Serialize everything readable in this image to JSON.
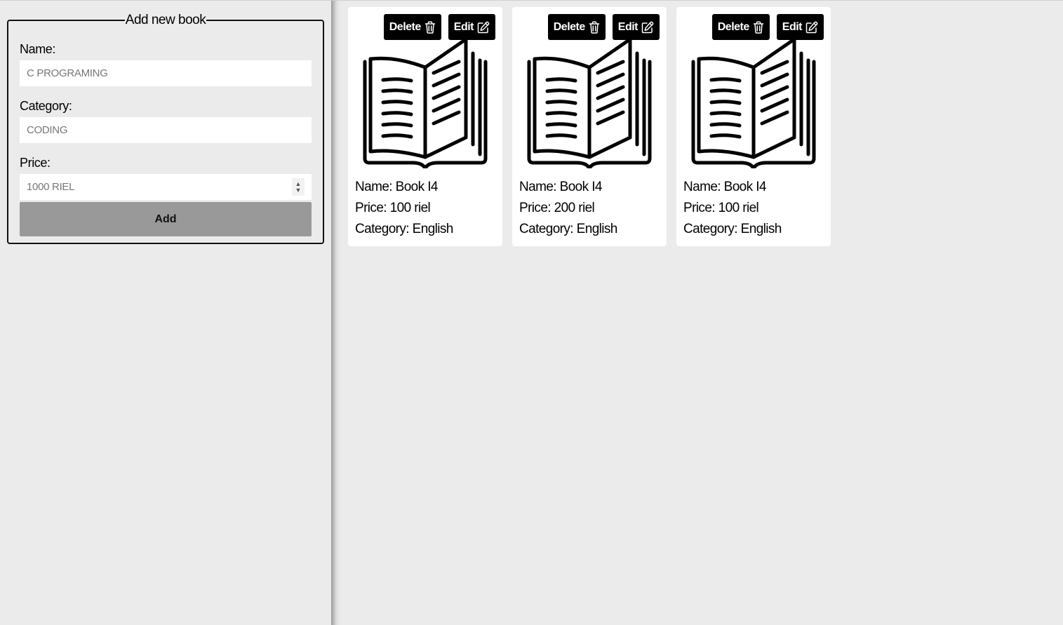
{
  "form": {
    "legend": "Add new book",
    "name_label": "Name:",
    "name_placeholder": "C PROGRAMING",
    "category_label": "Category:",
    "category_placeholder": "CODING",
    "price_label": "Price:",
    "price_placeholder": "1000 RIEL",
    "add_label": "Add"
  },
  "card_labels": {
    "delete": "Delete",
    "edit": "Edit",
    "name_prefix": "Name: ",
    "price_prefix": "Price: ",
    "category_prefix": "Category: "
  },
  "books": [
    {
      "name": "Book I4",
      "price": "100 riel",
      "category": "English"
    },
    {
      "name": "Book I4",
      "price": "200 riel",
      "category": "English"
    },
    {
      "name": "Book I4",
      "price": "100 riel",
      "category": "English"
    }
  ],
  "icons": {
    "delete": "trash-icon",
    "edit": "pencil-square-icon",
    "cover": "open-book-icon"
  },
  "colors": {
    "page_bg": "#ebebeb",
    "button_bg": "#000000",
    "add_button_bg": "#999999",
    "card_bg": "#ffffff"
  }
}
